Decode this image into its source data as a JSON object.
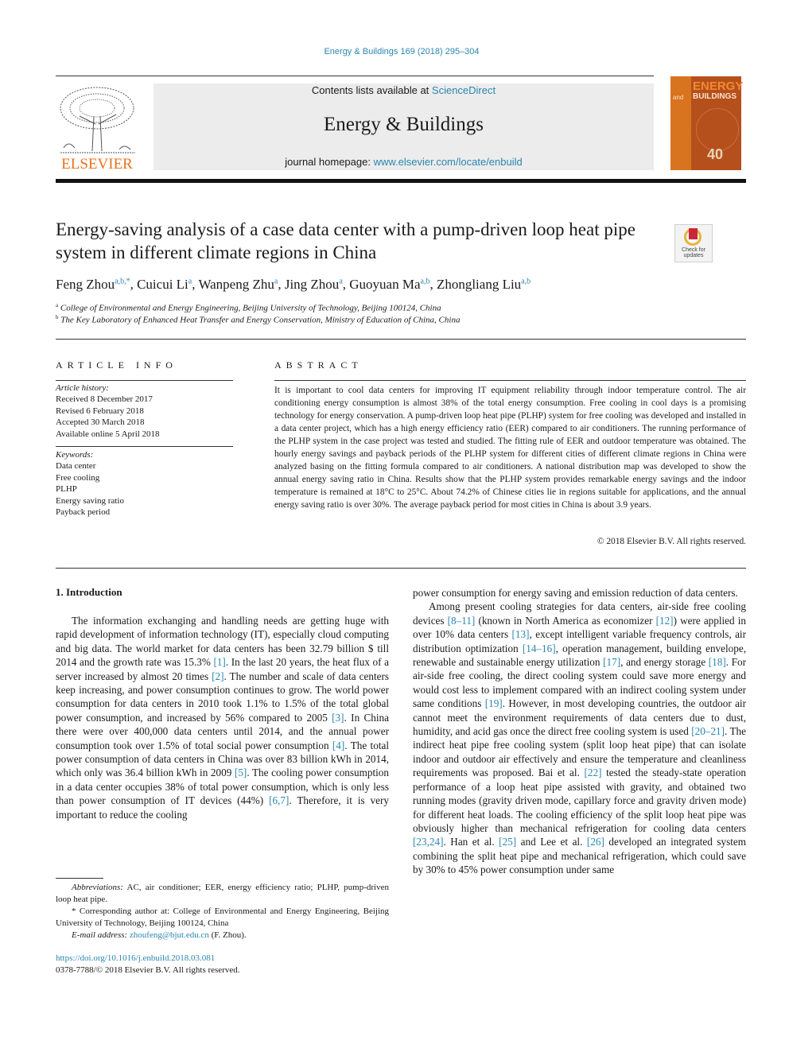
{
  "running_header": "Energy & Buildings 169 (2018) 295–304",
  "masthead": {
    "publisher_logo_text": "ELSEVIER",
    "contents_prefix": "Contents lists available at ",
    "contents_link": "ScienceDirect",
    "journal_title": "Energy & Buildings",
    "homepage_prefix": "journal homepage: ",
    "homepage_link": "www.elsevier.com/locate/enbuild",
    "cover": {
      "line1": "ENERGY",
      "line2": "BUILDINGS",
      "and": "and",
      "badge": "40"
    }
  },
  "crossmark": {
    "label_line1": "Check for",
    "label_line2": "updates"
  },
  "article": {
    "title": "Energy-saving analysis of a case data center with a pump-driven loop heat pipe system in different climate regions in China",
    "authors": [
      {
        "name": "Feng Zhou",
        "sup": "a,b,*"
      },
      {
        "name": "Cuicui Li",
        "sup": "a"
      },
      {
        "name": "Wanpeng Zhu",
        "sup": "a"
      },
      {
        "name": "Jing Zhou",
        "sup": "a"
      },
      {
        "name": "Guoyuan Ma",
        "sup": "a,b"
      },
      {
        "name": "Zhongliang Liu",
        "sup": "a,b"
      }
    ],
    "affiliations": [
      {
        "mark": "a",
        "text": "College of Environmental and Energy Engineering, Beijing University of Technology, Beijing 100124, China"
      },
      {
        "mark": "b",
        "text": "The Key Laboratory of Enhanced Heat Transfer and Energy Conservation, Ministry of Education of China, China"
      }
    ]
  },
  "article_info": {
    "heading": "ARTICLE INFO",
    "history_label": "Article history:",
    "history": [
      "Received 8 December 2017",
      "Revised 6 February 2018",
      "Accepted 30 March 2018",
      "Available online 5 April 2018"
    ],
    "keywords_label": "Keywords:",
    "keywords": [
      "Data center",
      "Free cooling",
      "PLHP",
      "Energy saving ratio",
      "Payback period"
    ]
  },
  "abstract": {
    "heading": "ABSTRACT",
    "text": "It is important to cool data centers for improving IT equipment reliability through indoor temperature control. The air conditioning energy consumption is almost 38% of the total energy consumption. Free cooling in cool days is a promising technology for energy conservation. A pump-driven loop heat pipe (PLHP) system for free cooling was developed and installed in a data center project, which has a high energy efficiency ratio (EER) compared to air conditioners. The running performance of the PLHP system in the case project was tested and studied. The fitting rule of EER and outdoor temperature was obtained. The hourly energy savings and payback periods of the PLHP system for different cities of different climate regions in China were analyzed basing on the fitting formula compared to air conditioners. A national distribution map was developed to show the annual energy saving ratio in China. Results show that the PLHP system provides remarkable energy savings and the indoor temperature is remained at 18°C to 25°C. About 74.2% of Chinese cities lie in regions suitable for applications, and the annual energy saving ratio is over 30%. The average payback period for most cities in China is about 3.9 years.",
    "copyright": "© 2018 Elsevier B.V. All rights reserved."
  },
  "introduction": {
    "heading": "1. Introduction",
    "left_column": [
      {
        "t": "The information exchanging and handling needs are getting huge with rapid development of information technology (IT), especially cloud computing and big data. The world market for data centers has been 32.79 billion $ till 2014 and the growth rate was 15.3% "
      },
      {
        "ref": "[1]"
      },
      {
        "t": ". In the last 20 years, the heat flux of a server increased by almost 20 times "
      },
      {
        "ref": "[2]"
      },
      {
        "t": ". The number and scale of data centers keep increasing, and power consumption continues to grow. The world power consumption for data centers in 2010 took 1.1% to 1.5% of the total global power consumption, and increased by 56% compared to 2005 "
      },
      {
        "ref": "[3]"
      },
      {
        "t": ". In China there were over 400,000 data centers until 2014, and the annual power consumption took over 1.5% of total social power consumption "
      },
      {
        "ref": "[4]"
      },
      {
        "t": ". The total power consumption of data centers in China was over 83 billion kWh in 2014, which only was 36.4 billion kWh in 2009 "
      },
      {
        "ref": "[5]"
      },
      {
        "t": ". The cooling power consumption in a data center occupies 38% of total power consumption, which is only less than power consumption of IT devices (44%) "
      },
      {
        "ref": "[6,7]"
      },
      {
        "t": ". Therefore, it is very important to reduce the cooling"
      }
    ],
    "right_column_p1": "power consumption for energy saving and emission reduction of data centers.",
    "right_column_p2": [
      {
        "t": "Among present cooling strategies for data centers, air-side free cooling devices "
      },
      {
        "ref": "[8–11]"
      },
      {
        "t": " (known in North America as economizer "
      },
      {
        "ref": "[12]"
      },
      {
        "t": ") were applied in over 10% data centers "
      },
      {
        "ref": "[13]"
      },
      {
        "t": ", except intelligent variable frequency controls, air distribution optimization "
      },
      {
        "ref": "[14–16]"
      },
      {
        "t": ", operation management, building envelope, renewable and sustainable energy utilization "
      },
      {
        "ref": "[17]"
      },
      {
        "t": ", and energy storage "
      },
      {
        "ref": "[18]"
      },
      {
        "t": ". For air-side free cooling, the direct cooling system could save more energy and would cost less to implement compared with an indirect cooling system under same conditions "
      },
      {
        "ref": "[19]"
      },
      {
        "t": ". However, in most developing countries, the outdoor air cannot meet the environment requirements of data centers due to dust, humidity, and acid gas once the direct free cooling system is used "
      },
      {
        "ref": "[20–21]"
      },
      {
        "t": ". The indirect heat pipe free cooling system (split loop heat pipe) that can isolate indoor and outdoor air effectively and ensure the temperature and cleanliness requirements was proposed. Bai et al. "
      },
      {
        "ref": "[22]"
      },
      {
        "t": " tested the steady-state operation performance of a loop heat pipe assisted with gravity, and obtained two running modes (gravity driven mode, capillary force and gravity driven mode) for different heat loads. The cooling efficiency of the split loop heat pipe was obviously higher than mechanical refrigeration for cooling data centers "
      },
      {
        "ref": "[23,24]"
      },
      {
        "t": ". Han et al. "
      },
      {
        "ref": "[25]"
      },
      {
        "t": " and Lee et al. "
      },
      {
        "ref": "[26]"
      },
      {
        "t": " developed an integrated system combining the split heat pipe and mechanical refrigeration, which could save by 30% to 45% power consumption under same"
      }
    ]
  },
  "footnotes": {
    "abbrev_label": "Abbreviations:",
    "abbrev_text": " AC, air conditioner; EER, energy efficiency ratio; PLHP, pump-driven loop heat pipe.",
    "corresponding_mark": "*",
    "corresponding_text": " Corresponding author at: College of Environmental and Energy Engineering, Beijing University of Technology, Beijing 100124, China",
    "email_label": "E-mail address:",
    "email": "zhoufeng@bjut.edu.cn",
    "email_suffix": " (F. Zhou).",
    "doi": "https://doi.org/10.1016/j.enbuild.2018.03.081",
    "issn_copyright": "0378-7788/© 2018 Elsevier B.V. All rights reserved."
  },
  "colors": {
    "link": "#2a86b0",
    "elsevier_orange": "#e9711c",
    "masthead_bg": "#ececec"
  }
}
